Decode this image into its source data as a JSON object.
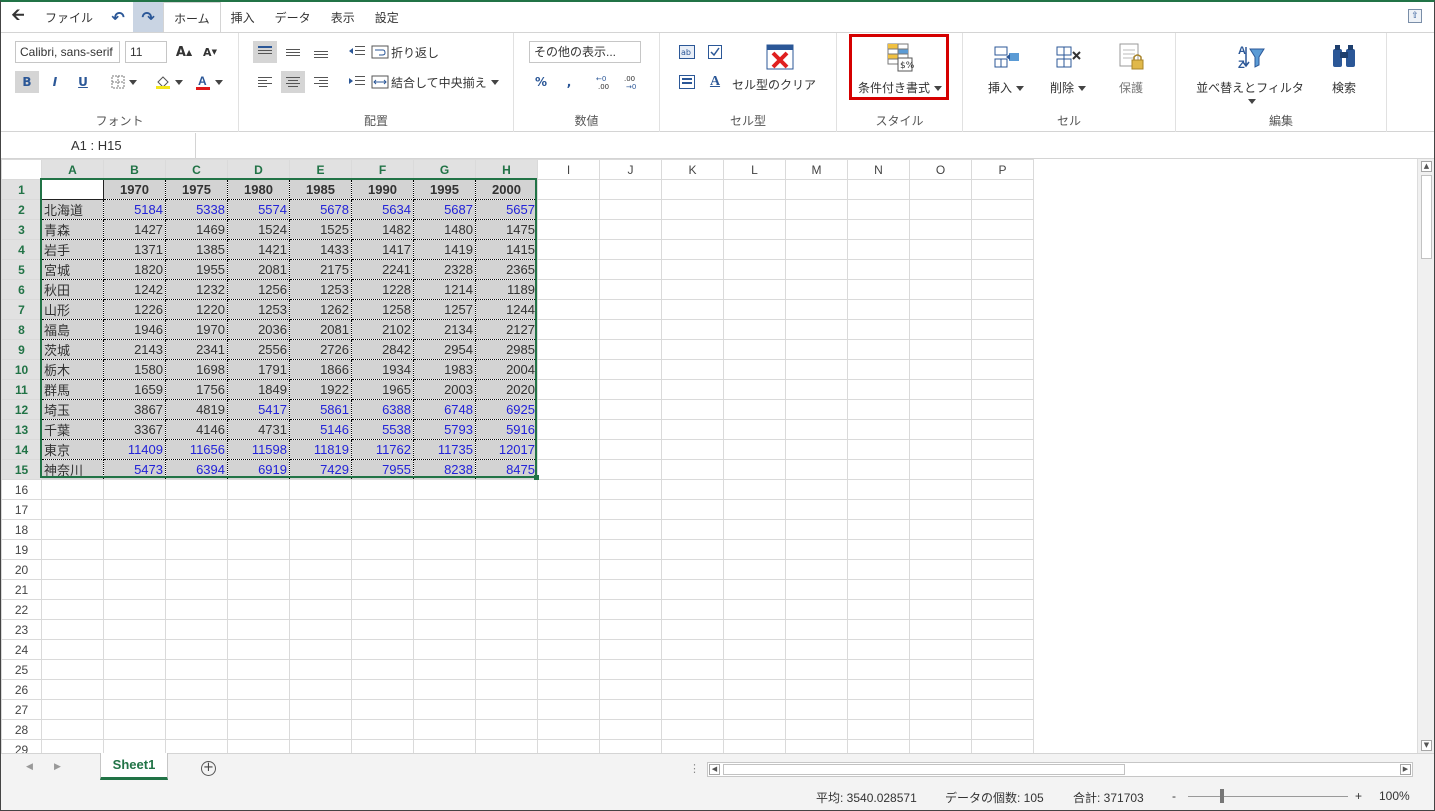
{
  "menu": {
    "file": "ファイル",
    "tabs": [
      "ホーム",
      "挿入",
      "データ",
      "表示",
      "設定"
    ]
  },
  "ribbon": {
    "font": {
      "title": "フォント",
      "family": "Calibri, sans-serif",
      "size": "11",
      "bold": "B",
      "italic": "I",
      "underline": "U"
    },
    "alignment": {
      "title": "配置",
      "wrap": "折り返し",
      "merge": "結合して中央揃え"
    },
    "number": {
      "title": "数値",
      "format": "その他の表示...",
      "percent": "%",
      "comma": ","
    },
    "cellstyle": {
      "title": "セル型",
      "clear": "セル型のクリア"
    },
    "style": {
      "title": "スタイル",
      "conditional": "条件付き書式"
    },
    "cells": {
      "title": "セル",
      "insert": "挿入",
      "delete": "削除",
      "protect": "保護"
    },
    "editing": {
      "title": "編集",
      "sort": "並べ替えとフィルタ",
      "find": "検索"
    }
  },
  "namebox": "A1 : H15",
  "columns": [
    "A",
    "B",
    "C",
    "D",
    "E",
    "F",
    "G",
    "H",
    "I",
    "J",
    "K",
    "L",
    "M",
    "N",
    "O",
    "P"
  ],
  "year_headers": [
    "1970",
    "1975",
    "1980",
    "1985",
    "1990",
    "1995",
    "2000"
  ],
  "rows": [
    {
      "label": "北海道",
      "values": [
        "5184",
        "5338",
        "5574",
        "5678",
        "5634",
        "5687",
        "5657"
      ],
      "blue": [
        1,
        1,
        1,
        1,
        1,
        1,
        1
      ]
    },
    {
      "label": "青森",
      "values": [
        "1427",
        "1469",
        "1524",
        "1525",
        "1482",
        "1480",
        "1475"
      ],
      "blue": [
        0,
        0,
        0,
        0,
        0,
        0,
        0
      ]
    },
    {
      "label": "岩手",
      "values": [
        "1371",
        "1385",
        "1421",
        "1433",
        "1417",
        "1419",
        "1415"
      ],
      "blue": [
        0,
        0,
        0,
        0,
        0,
        0,
        0
      ]
    },
    {
      "label": "宮城",
      "values": [
        "1820",
        "1955",
        "2081",
        "2175",
        "2241",
        "2328",
        "2365"
      ],
      "blue": [
        0,
        0,
        0,
        0,
        0,
        0,
        0
      ]
    },
    {
      "label": "秋田",
      "values": [
        "1242",
        "1232",
        "1256",
        "1253",
        "1228",
        "1214",
        "1189"
      ],
      "blue": [
        0,
        0,
        0,
        0,
        0,
        0,
        0
      ]
    },
    {
      "label": "山形",
      "values": [
        "1226",
        "1220",
        "1253",
        "1262",
        "1258",
        "1257",
        "1244"
      ],
      "blue": [
        0,
        0,
        0,
        0,
        0,
        0,
        0
      ]
    },
    {
      "label": "福島",
      "values": [
        "1946",
        "1970",
        "2036",
        "2081",
        "2102",
        "2134",
        "2127"
      ],
      "blue": [
        0,
        0,
        0,
        0,
        0,
        0,
        0
      ]
    },
    {
      "label": "茨城",
      "values": [
        "2143",
        "2341",
        "2556",
        "2726",
        "2842",
        "2954",
        "2985"
      ],
      "blue": [
        0,
        0,
        0,
        0,
        0,
        0,
        0
      ]
    },
    {
      "label": "栃木",
      "values": [
        "1580",
        "1698",
        "1791",
        "1866",
        "1934",
        "1983",
        "2004"
      ],
      "blue": [
        0,
        0,
        0,
        0,
        0,
        0,
        0
      ]
    },
    {
      "label": "群馬",
      "values": [
        "1659",
        "1756",
        "1849",
        "1922",
        "1965",
        "2003",
        "2020"
      ],
      "blue": [
        0,
        0,
        0,
        0,
        0,
        0,
        0
      ]
    },
    {
      "label": "埼玉",
      "values": [
        "3867",
        "4819",
        "5417",
        "5861",
        "6388",
        "6748",
        "6925"
      ],
      "blue": [
        0,
        0,
        1,
        1,
        1,
        1,
        1
      ]
    },
    {
      "label": "千葉",
      "values": [
        "3367",
        "4146",
        "4731",
        "5146",
        "5538",
        "5793",
        "5916"
      ],
      "blue": [
        0,
        0,
        0,
        1,
        1,
        1,
        1
      ]
    },
    {
      "label": "東京",
      "values": [
        "11409",
        "11656",
        "11598",
        "11819",
        "11762",
        "11735",
        "12017"
      ],
      "blue": [
        1,
        1,
        1,
        1,
        1,
        1,
        1
      ]
    },
    {
      "label": "神奈川",
      "values": [
        "5473",
        "6394",
        "6919",
        "7429",
        "7955",
        "8238",
        "8475"
      ],
      "blue": [
        1,
        1,
        1,
        1,
        1,
        1,
        1
      ]
    }
  ],
  "total_rows": 29,
  "sheet_tab": "Sheet1",
  "status": {
    "average": "平均: 3540.028571",
    "count": "データの個数: 105",
    "sum": "合計: 371703",
    "zoom_minus": "-",
    "zoom_plus": "+",
    "zoom": "100%"
  },
  "colors": {
    "accent": "#217346",
    "blue_text": "#2323d8",
    "highlight": "#d50000",
    "data_fill": "#d3d3d3"
  }
}
